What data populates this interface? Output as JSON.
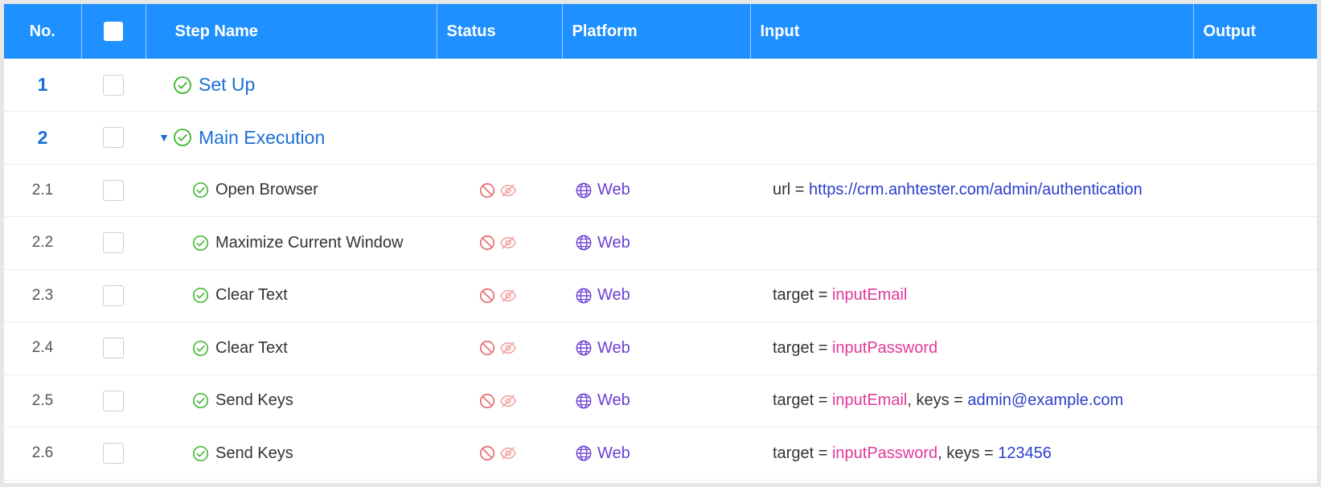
{
  "columns": {
    "no": "No.",
    "step_name": "Step Name",
    "status": "Status",
    "platform": "Platform",
    "input": "Input",
    "output": "Output"
  },
  "colors": {
    "header_bg": "#1e90ff",
    "group_text": "#1a6fd4",
    "success_icon": "#3cb62e",
    "status_icon": "#e86a6a",
    "platform": "#6b3fd6",
    "url_value": "#2a3fc9",
    "target_value": "#e0399a"
  },
  "icons": {
    "success": "check-circle-icon",
    "disabled": "ban-icon",
    "hidden": "eye-off-icon",
    "platform": "globe-icon",
    "expand": "caret-down-icon"
  },
  "rows": [
    {
      "no": "1",
      "name": "Set Up"
    },
    {
      "no": "2",
      "name": "Main Execution",
      "toggle": "▼"
    },
    {
      "no": "2.1",
      "name": "Open Browser",
      "platform": "Web",
      "input": {
        "k1": "url",
        "eq": " = ",
        "v1": "https://crm.anhtester.com/admin/authentication"
      }
    },
    {
      "no": "2.2",
      "name": "Maximize Current Window",
      "platform": "Web"
    },
    {
      "no": "2.3",
      "name": "Clear Text",
      "platform": "Web",
      "input": {
        "k1": "target",
        "eq": " = ",
        "v1": "inputEmail"
      }
    },
    {
      "no": "2.4",
      "name": "Clear Text",
      "platform": "Web",
      "input": {
        "k1": "target",
        "eq": " = ",
        "v1": "inputPassword"
      }
    },
    {
      "no": "2.5",
      "name": "Send Keys",
      "platform": "Web",
      "input": {
        "k1": "target",
        "eq": " = ",
        "v1": "inputEmail",
        "sep": ", ",
        "k2": "keys",
        "v2": "admin@example.com"
      }
    },
    {
      "no": "2.6",
      "name": "Send Keys",
      "platform": "Web",
      "input": {
        "k1": "target",
        "eq": " = ",
        "v1": "inputPassword",
        "sep": ", ",
        "k2": "keys",
        "v2": "123456"
      }
    }
  ]
}
